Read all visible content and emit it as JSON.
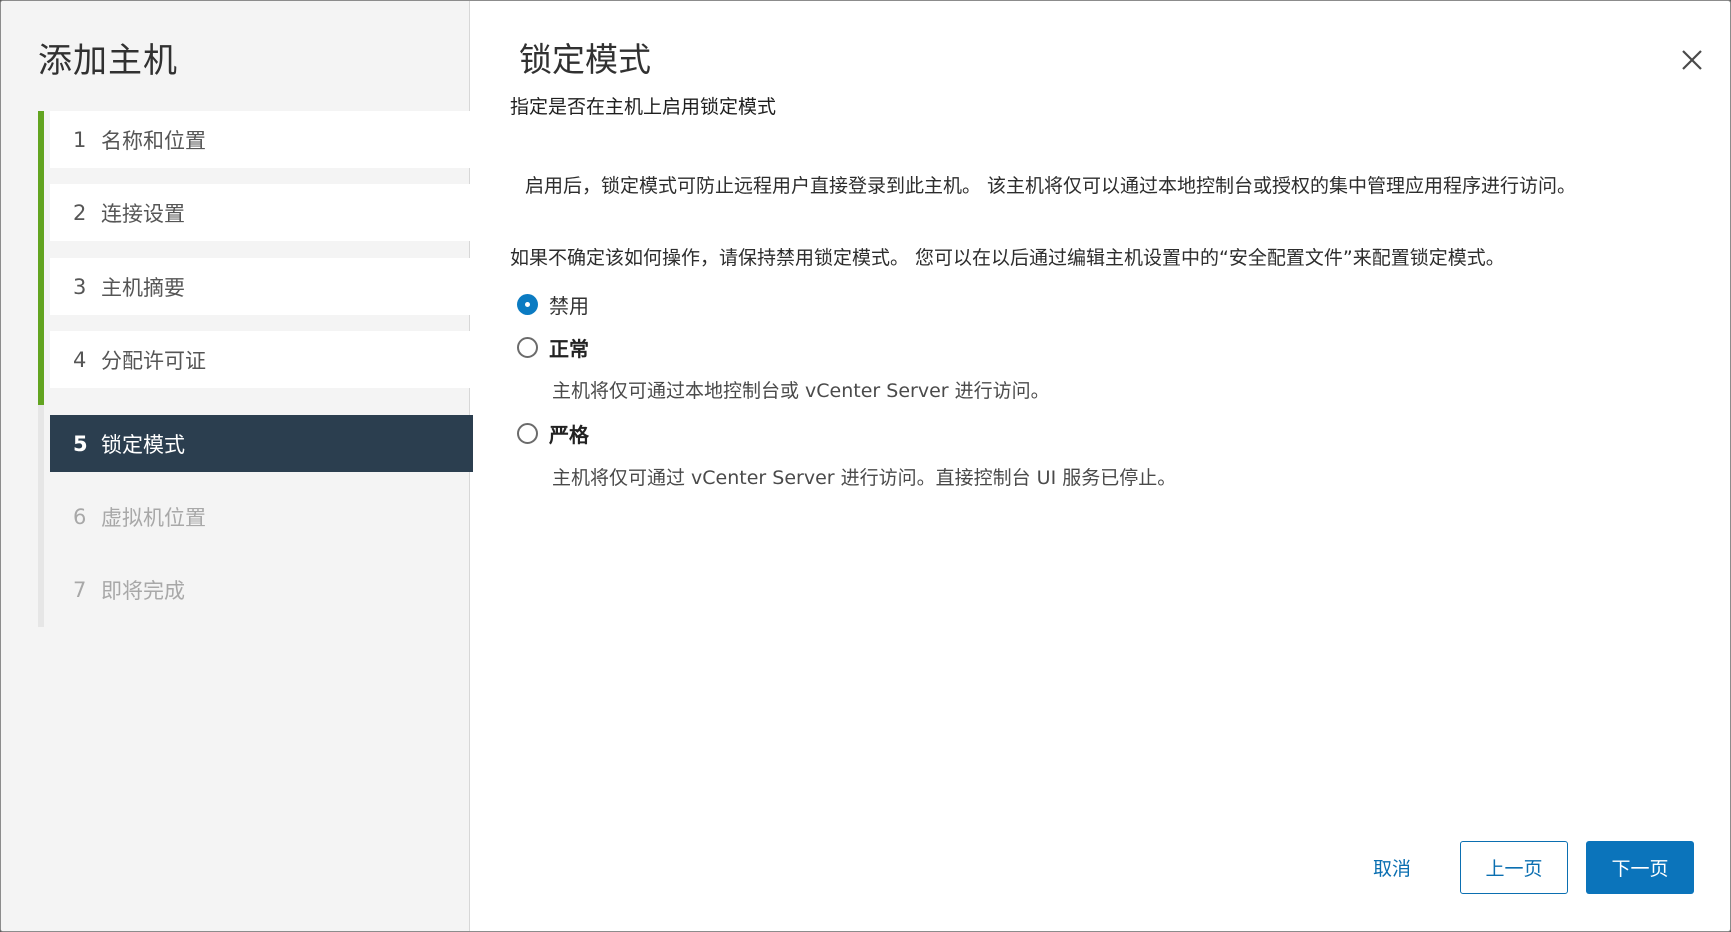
{
  "wizard": {
    "title": "添加主机",
    "steps": [
      {
        "num": "1",
        "label": "名称和位置",
        "state": "completed"
      },
      {
        "num": "2",
        "label": "连接设置",
        "state": "completed"
      },
      {
        "num": "3",
        "label": "主机摘要",
        "state": "completed"
      },
      {
        "num": "4",
        "label": "分配许可证",
        "state": "completed"
      },
      {
        "num": "5",
        "label": "锁定模式",
        "state": "current"
      },
      {
        "num": "6",
        "label": "虚拟机位置",
        "state": "disabled"
      },
      {
        "num": "7",
        "label": "即将完成",
        "state": "disabled"
      }
    ]
  },
  "page": {
    "title": "锁定模式",
    "subtitle": "指定是否在主机上启用锁定模式",
    "paragraph1": "启用后，锁定模式可防止远程用户直接登录到此主机。 该主机将仅可以通过本地控制台或授权的集中管理应用程序进行访问。",
    "paragraph2": "如果不确定该如何操作，请保持禁用锁定模式。 您可以在以后通过编辑主机设置中的“安全配置文件”来配置锁定模式。",
    "options": [
      {
        "label": "禁用",
        "selected": true,
        "description": ""
      },
      {
        "label": "正常",
        "selected": false,
        "description": "主机将仅可通过本地控制台或 vCenter Server 进行访问。"
      },
      {
        "label": "严格",
        "selected": false,
        "description": "主机将仅可通过 vCenter Server 进行访问。直接控制台 UI 服务已停止。"
      }
    ]
  },
  "footer": {
    "cancel_label": "取消",
    "back_label": "上一页",
    "next_label": "下一页"
  },
  "colors": {
    "progress": "#62a420",
    "current_step_bg": "#2b3e4f",
    "primary": "#0b74bb"
  },
  "icons": {
    "close": "close-icon"
  }
}
